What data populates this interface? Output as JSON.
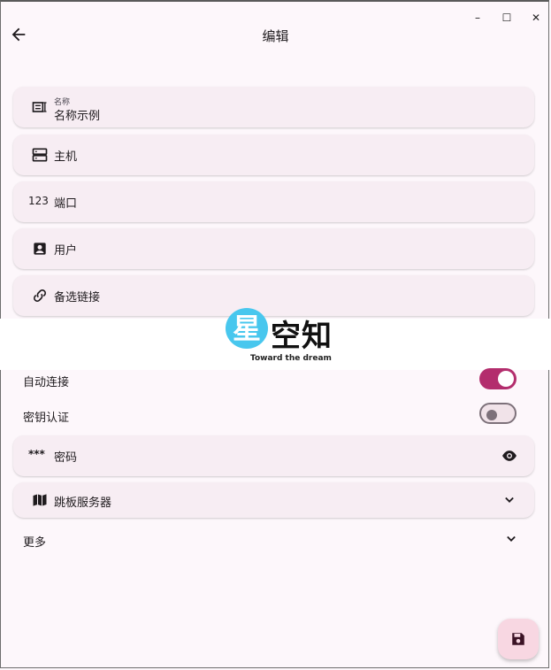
{
  "window": {
    "minimize": "–",
    "maximize": "☐",
    "close": "✕"
  },
  "appbar": {
    "title": "编辑"
  },
  "fields": {
    "name": {
      "label": "名称",
      "value": "名称示例"
    },
    "host": {
      "label": "主机"
    },
    "port": {
      "prefix": "123",
      "label": "端口"
    },
    "user": {
      "label": "用户"
    },
    "alt_link": {
      "label": "备选链接"
    },
    "password": {
      "prefix": "***",
      "label": "密码"
    },
    "jump_server": {
      "label": "跳板服务器"
    }
  },
  "toggles": {
    "auto_connect": {
      "label": "自动连接",
      "on": true
    },
    "key_auth": {
      "label": "密钥认证",
      "on": false
    }
  },
  "more": {
    "label": "更多"
  },
  "watermark": {
    "badge": "星",
    "text": "空知",
    "sub": "Toward the dream"
  },
  "colors": {
    "background": "#fdf7fb",
    "field_bg": "#f7edf3",
    "accent": "#b32d6d",
    "fab_bg": "#f8d7e2"
  }
}
